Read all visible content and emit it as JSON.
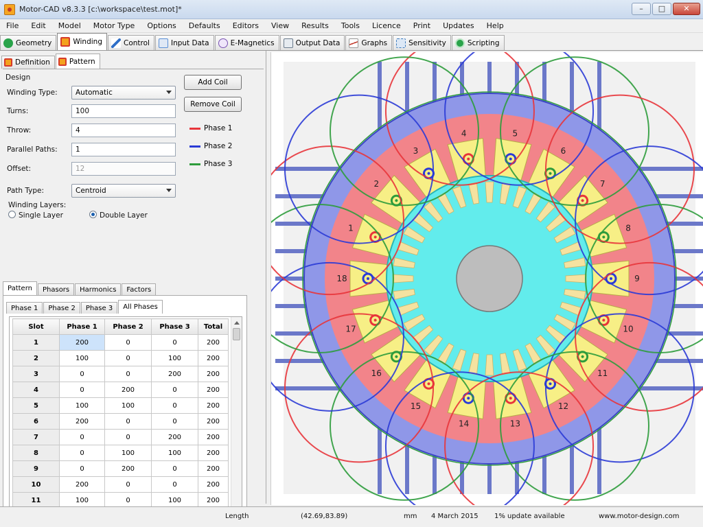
{
  "window": {
    "title": "Motor-CAD v8.3.3 [c:\\workspace\\test.mot]*"
  },
  "menu": [
    "File",
    "Edit",
    "Model",
    "Motor Type",
    "Options",
    "Defaults",
    "Editors",
    "View",
    "Results",
    "Tools",
    "Licence",
    "Print",
    "Updates",
    "Help"
  ],
  "main_tabs": [
    {
      "label": "Geometry",
      "icon": "geometry-icon",
      "color": "#2aa34a"
    },
    {
      "label": "Winding",
      "icon": "winding-icon",
      "color": "#f3a21e"
    },
    {
      "label": "Control",
      "icon": "control-icon",
      "color": "#2f6fc8"
    },
    {
      "label": "Input Data",
      "icon": "input-data-icon",
      "color": "#5a8fd6"
    },
    {
      "label": "E-Magnetics",
      "icon": "emagnetics-icon",
      "color": "#7a52b3"
    },
    {
      "label": "Output Data",
      "icon": "output-data-icon",
      "color": "#6b7b8c"
    },
    {
      "label": "Graphs",
      "icon": "graphs-icon",
      "color": "#c0392b"
    },
    {
      "label": "Sensitivity",
      "icon": "sensitivity-icon",
      "color": "#3c7bbd"
    },
    {
      "label": "Scripting",
      "icon": "scripting-icon",
      "color": "#2aa34a"
    }
  ],
  "sub_tabs": [
    {
      "label": "Definition"
    },
    {
      "label": "Pattern"
    }
  ],
  "design": {
    "group_label": "Design",
    "winding_type_label": "Winding Type:",
    "winding_type": "Automatic",
    "turns_label": "Turns:",
    "turns": "100",
    "throw_label": "Throw:",
    "throw": "4",
    "parallel_label": "Parallel Paths:",
    "parallel": "1",
    "offset_label": "Offset:",
    "offset": "12",
    "path_type_label": "Path Type:",
    "path_type": "Centroid",
    "layers_label": "Winding Layers:",
    "single": "Single Layer",
    "double": "Double Layer",
    "add_coil": "Add Coil",
    "remove_coil": "Remove Coil"
  },
  "legend": [
    {
      "label": "Phase 1",
      "color": "#e8353b"
    },
    {
      "label": "Phase 2",
      "color": "#2b3bd6"
    },
    {
      "label": "Phase 3",
      "color": "#2e9c3c"
    }
  ],
  "lower_tabs": [
    "Pattern",
    "Phasors",
    "Harmonics",
    "Factors"
  ],
  "phase_tabs": [
    "Phase 1",
    "Phase 2",
    "Phase 3",
    "All Phases"
  ],
  "table": {
    "headers": [
      "Slot",
      "Phase 1",
      "Phase 2",
      "Phase 3",
      "Total"
    ],
    "rows": [
      [
        "1",
        "200",
        "0",
        "0",
        "200"
      ],
      [
        "2",
        "100",
        "0",
        "100",
        "200"
      ],
      [
        "3",
        "0",
        "0",
        "200",
        "200"
      ],
      [
        "4",
        "0",
        "200",
        "0",
        "200"
      ],
      [
        "5",
        "100",
        "100",
        "0",
        "200"
      ],
      [
        "6",
        "200",
        "0",
        "0",
        "200"
      ],
      [
        "7",
        "0",
        "0",
        "200",
        "200"
      ],
      [
        "8",
        "0",
        "100",
        "100",
        "200"
      ],
      [
        "9",
        "0",
        "200",
        "0",
        "200"
      ],
      [
        "10",
        "200",
        "0",
        "0",
        "200"
      ],
      [
        "11",
        "100",
        "0",
        "100",
        "200"
      ]
    ]
  },
  "status": {
    "length": "Length",
    "coords": "(42.69,83.89)",
    "unit": "mm",
    "date": "4 March 2015",
    "updates": "1% update available",
    "site": "www.motor-design.com"
  },
  "slot_numbers": [
    "1",
    "2",
    "3",
    "4",
    "5",
    "6",
    "7",
    "8",
    "9",
    "10",
    "11",
    "12",
    "13",
    "14",
    "15",
    "16",
    "17",
    "18"
  ]
}
